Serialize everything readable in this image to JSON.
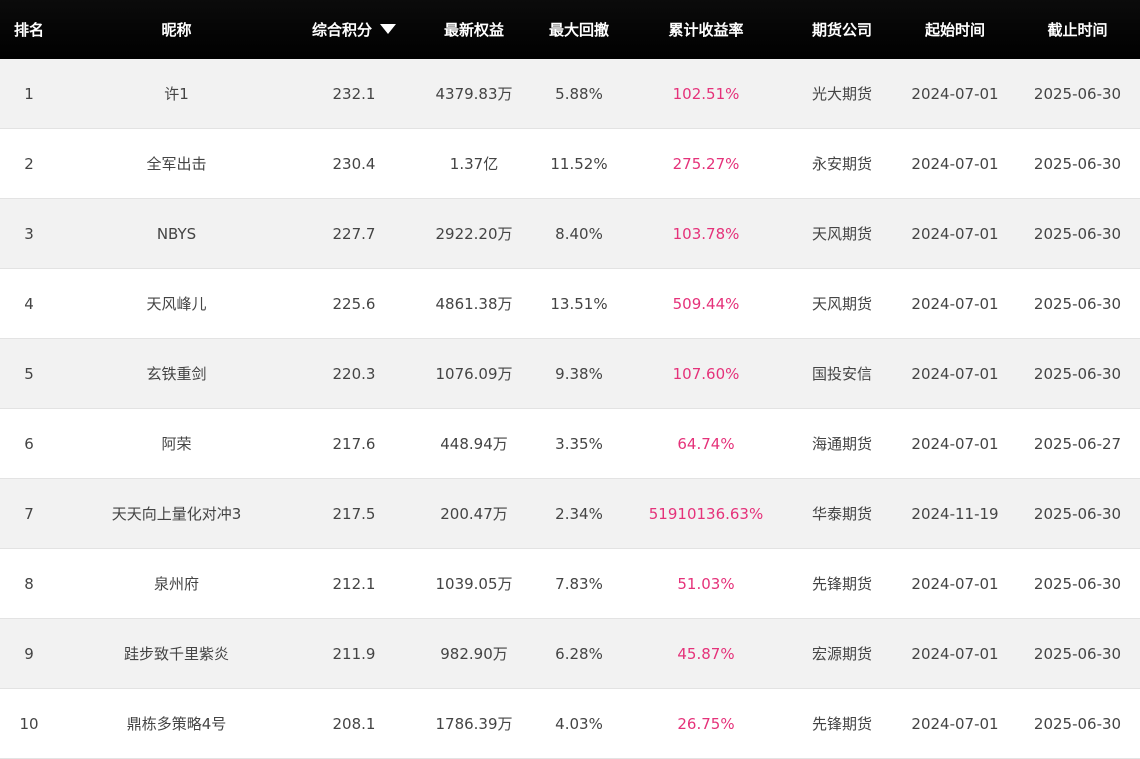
{
  "theme": {
    "header_bg": "#000000",
    "header_text": "#ffffff",
    "row_alt_bg": "#f2f2f2",
    "text": "#444444",
    "return_color": "#e5327a"
  },
  "table": {
    "columns": {
      "rank": "排名",
      "nickname": "昵称",
      "score": "综合积分",
      "equity": "最新权益",
      "drawdown": "最大回撤",
      "return": "累计收益率",
      "company": "期货公司",
      "start": "起始时间",
      "end": "截止时间"
    },
    "sort_icon": "triangle-down-icon",
    "rows": [
      {
        "rank": "1",
        "nickname": "许1",
        "score": "232.1",
        "equity": "4379.83万",
        "drawdown": "5.88%",
        "return": "102.51%",
        "company": "光大期货",
        "start": "2024-07-01",
        "end": "2025-06-30"
      },
      {
        "rank": "2",
        "nickname": "全军出击",
        "score": "230.4",
        "equity": "1.37亿",
        "drawdown": "11.52%",
        "return": "275.27%",
        "company": "永安期货",
        "start": "2024-07-01",
        "end": "2025-06-30"
      },
      {
        "rank": "3",
        "nickname": "NBYS",
        "score": "227.7",
        "equity": "2922.20万",
        "drawdown": "8.40%",
        "return": "103.78%",
        "company": "天风期货",
        "start": "2024-07-01",
        "end": "2025-06-30"
      },
      {
        "rank": "4",
        "nickname": "天风峰儿",
        "score": "225.6",
        "equity": "4861.38万",
        "drawdown": "13.51%",
        "return": "509.44%",
        "company": "天风期货",
        "start": "2024-07-01",
        "end": "2025-06-30"
      },
      {
        "rank": "5",
        "nickname": "玄铁重剑",
        "score": "220.3",
        "equity": "1076.09万",
        "drawdown": "9.38%",
        "return": "107.60%",
        "company": "国投安信",
        "start": "2024-07-01",
        "end": "2025-06-30"
      },
      {
        "rank": "6",
        "nickname": "阿荣",
        "score": "217.6",
        "equity": "448.94万",
        "drawdown": "3.35%",
        "return": "64.74%",
        "company": "海通期货",
        "start": "2024-07-01",
        "end": "2025-06-27"
      },
      {
        "rank": "7",
        "nickname": "天天向上量化对冲3",
        "score": "217.5",
        "equity": "200.47万",
        "drawdown": "2.34%",
        "return": "51910136.63%",
        "company": "华泰期货",
        "start": "2024-11-19",
        "end": "2025-06-30"
      },
      {
        "rank": "8",
        "nickname": "泉州府",
        "score": "212.1",
        "equity": "1039.05万",
        "drawdown": "7.83%",
        "return": "51.03%",
        "company": "先锋期货",
        "start": "2024-07-01",
        "end": "2025-06-30"
      },
      {
        "rank": "9",
        "nickname": "跬步致千里紫炎",
        "score": "211.9",
        "equity": "982.90万",
        "drawdown": "6.28%",
        "return": "45.87%",
        "company": "宏源期货",
        "start": "2024-07-01",
        "end": "2025-06-30"
      },
      {
        "rank": "10",
        "nickname": "鼎栋多策略4号",
        "score": "208.1",
        "equity": "1786.39万",
        "drawdown": "4.03%",
        "return": "26.75%",
        "company": "先锋期货",
        "start": "2024-07-01",
        "end": "2025-06-30"
      }
    ]
  }
}
